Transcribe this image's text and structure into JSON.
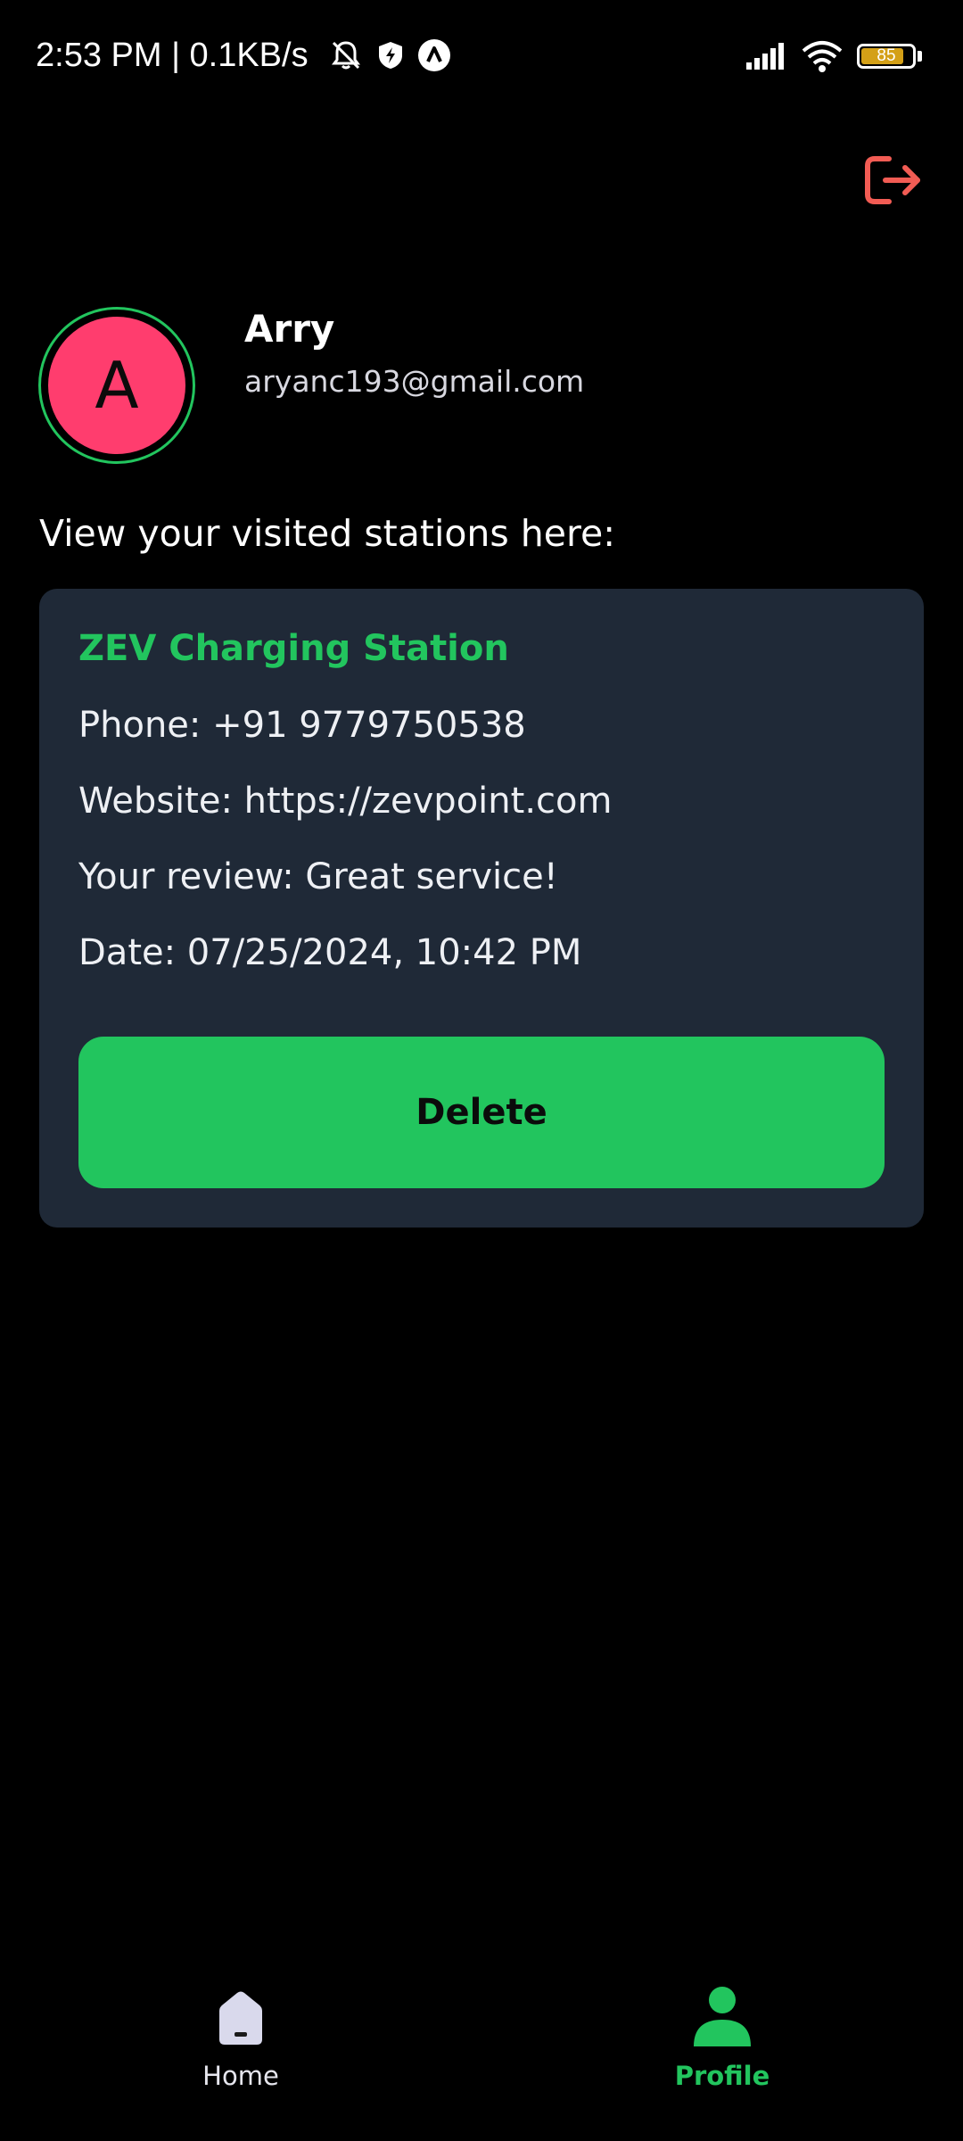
{
  "status_bar": {
    "time_speed": "2:53 PM | 0.1KB/s",
    "battery_level": "85",
    "battery_fraction": 0.85,
    "icons": [
      "bell-off-icon",
      "shield-bolt-icon",
      "app-a-icon",
      "signal-icon",
      "wifi-icon",
      "battery-icon"
    ]
  },
  "header": {
    "logout_icon": "logout-icon",
    "logout_color": "#f25c54"
  },
  "profile": {
    "avatar_letter": "A",
    "name": "Arry",
    "email": "aryanc193@gmail.com",
    "avatar_color": "#ff3d6e",
    "ring_color": "#22c55e"
  },
  "section": {
    "heading": "View your visited stations here:"
  },
  "stations": [
    {
      "name": "ZEV Charging Station",
      "phone": "Phone: +91 9779750538",
      "website": "Website: https://zevpoint.com",
      "review": "Your review: Great service!",
      "date": "Date: 07/25/2024, 10:42 PM",
      "delete_label": "Delete"
    }
  ],
  "bottom_nav": {
    "items": [
      {
        "label": "Home",
        "icon": "home-icon",
        "active": false
      },
      {
        "label": "Profile",
        "icon": "profile-icon",
        "active": true
      }
    ],
    "active_color": "#22c55e"
  }
}
